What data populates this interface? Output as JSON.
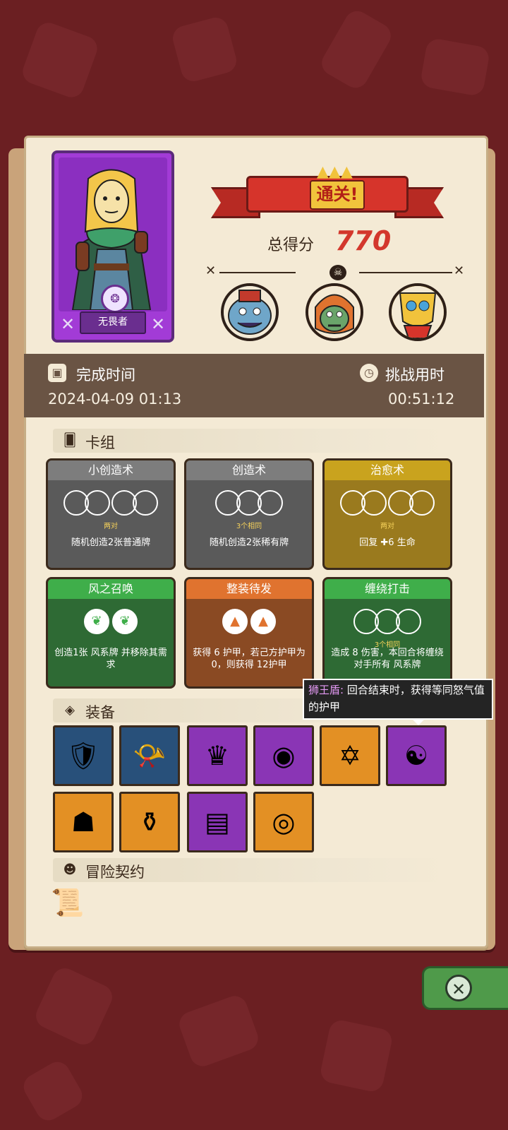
{
  "hero": {
    "name": "无畏者",
    "emblem_icon": "hero-emblem-icon"
  },
  "result": {
    "banner_title": "通关!",
    "score_label": "总得分",
    "score_value": "770"
  },
  "bosses": [
    {
      "name": "boss-blue-ogre",
      "color": "#5f8fb0"
    },
    {
      "name": "boss-orange-troll",
      "color": "#e0732f"
    },
    {
      "name": "boss-yellow-mask",
      "color": "#f1c33c"
    }
  ],
  "info": {
    "completion_label": "完成时间",
    "completion_value": "2024-04-09 01:13",
    "duration_label": "挑战用时",
    "duration_value": "00:51:12"
  },
  "deck": {
    "title": "卡组",
    "cards": [
      {
        "name": "小创造术",
        "sub": "两对",
        "desc": "随机创造2张普通牌",
        "color": "gray",
        "circles": 2
      },
      {
        "name": "创造术",
        "sub": "3个相同",
        "desc": "随机创造2张稀有牌",
        "color": "gray",
        "circles": 3
      },
      {
        "name": "治愈术",
        "sub": "两对",
        "desc": "回复 ✚6 生命",
        "color": "yellow",
        "circles": 2
      },
      {
        "name": "风之召唤",
        "sub": "",
        "desc": "创造1张 风系牌 并移除其需求",
        "color": "green",
        "circles": 2
      },
      {
        "name": "整装待发",
        "sub": "",
        "desc": "获得 6 护甲，若己方护甲为0，则获得 12护甲",
        "color": "orange",
        "circles": 2
      },
      {
        "name": "缠绕打击",
        "sub": "3个相同",
        "desc": "造成 8 伤害，本回合将缠绕对手所有 风系牌",
        "color": "green",
        "circles": 3
      }
    ]
  },
  "tooltip": {
    "name": "狮王盾:",
    "text": " 回合结束时，获得等同怒气值的护甲"
  },
  "equipment": {
    "title": "装备",
    "items": [
      {
        "name": "armor-vest-icon",
        "color": "blue"
      },
      {
        "name": "horn-icon",
        "color": "blue"
      },
      {
        "name": "crown-icon",
        "color": "purple"
      },
      {
        "name": "bracer-icon",
        "color": "purple"
      },
      {
        "name": "hexagram-icon",
        "color": "orange"
      },
      {
        "name": "lion-shield-icon",
        "color": "purple"
      },
      {
        "name": "hood-icon",
        "color": "orange"
      },
      {
        "name": "potion-jar-icon",
        "color": "orange"
      },
      {
        "name": "spellbook-icon",
        "color": "purple"
      },
      {
        "name": "orb-icon",
        "color": "orange"
      }
    ]
  },
  "contract": {
    "title": "冒险契约"
  }
}
